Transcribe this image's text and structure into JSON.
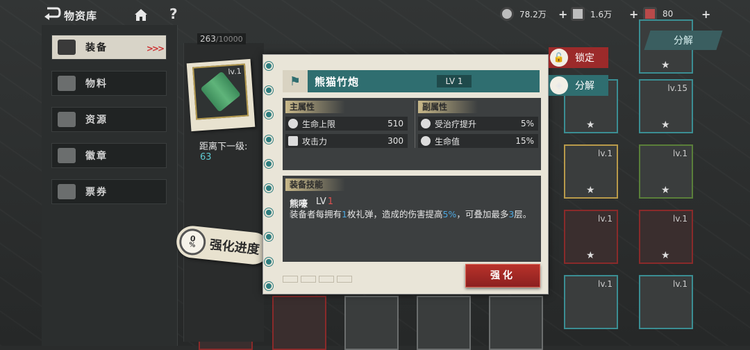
{
  "topbar": {
    "title": "物资库",
    "currencies": [
      {
        "icon": "coin-icon",
        "value": "78.2万"
      },
      {
        "icon": "ticket-icon",
        "value": "1.6万"
      },
      {
        "icon": "gem-icon",
        "value": "80"
      }
    ],
    "help": "?"
  },
  "nav": {
    "items": [
      {
        "label": "装备",
        "active": true
      },
      {
        "label": "物料"
      },
      {
        "label": "资源"
      },
      {
        "label": "徽章"
      },
      {
        "label": "票券"
      }
    ],
    "active_arrows": ">>>"
  },
  "inventory": {
    "count": "263",
    "capacity": "/10000",
    "decompose_label": "分解"
  },
  "preview": {
    "level": "lv.1",
    "next_level_label": "距离下一级:",
    "next_level_value": "63",
    "progress_value": "0",
    "progress_unit": "%",
    "progress_label": "强化进度"
  },
  "grid": {
    "levels": [
      "lv.15",
      "lv.1",
      "lv.1",
      "lv.1",
      "lv.1",
      "lv.1",
      "lv.1"
    ]
  },
  "detail": {
    "name": "熊猫竹炮",
    "level": "LV 1",
    "main_attr_title": "主属性",
    "sub_attr_title": "副属性",
    "main_attrs": [
      {
        "name": "生命上限",
        "value": "510"
      },
      {
        "name": "攻击力",
        "value": "300"
      }
    ],
    "sub_attrs": [
      {
        "name": "受治疗提升",
        "value": "5%"
      },
      {
        "name": "生命值",
        "value": "15%"
      }
    ],
    "skill_title": "装备技能",
    "skill_name": "熊嚎",
    "skill_lv_prefix": "LV",
    "skill_lv_num": "1",
    "skill_desc_parts": [
      "装备者每拥有",
      "1",
      "枚礼弹，造成的伤害提高",
      "5%",
      "，可叠加最多",
      "3",
      "层。"
    ],
    "enhance_label": "强化"
  },
  "side_actions": {
    "lock_label": "锁定",
    "decompose_label": "分解"
  },
  "colors": {
    "teal": "#2f6e70",
    "red": "#9c2a2a",
    "highlight": "#4da8e0",
    "paper": "#e9e5d8"
  }
}
